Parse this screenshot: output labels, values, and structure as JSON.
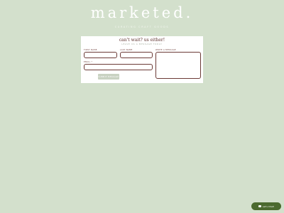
{
  "brand": {
    "name": "marketed.",
    "tagline": "CURATING CRAFT GOODS"
  },
  "form": {
    "title": "can't wait? us either!",
    "subtitle": "LEAVE US A MESSAGE TODAY",
    "first_label": "FIRST NAME",
    "last_label": "LAST NAME",
    "email_label": "EMAIL *",
    "message_label": "WRITE A MESSAGE",
    "first_value": "",
    "last_value": "",
    "email_value": "",
    "message_value": "",
    "submit_label": "SUBMIT MESSAGE"
  },
  "chat": {
    "label": "Let's Chat!",
    "icon": "chat-bubble-icon"
  },
  "colors": {
    "background": "#d3e0cc",
    "accent": "#6b3a36",
    "chat": "#4b6a2e"
  }
}
